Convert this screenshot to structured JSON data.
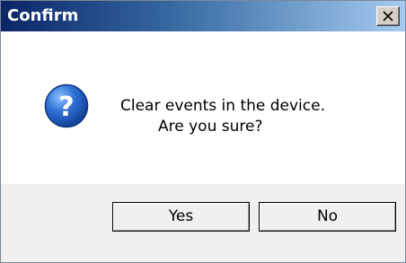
{
  "dialog": {
    "title": "Confirm",
    "close_icon": "close-icon",
    "question_icon": "question-icon",
    "message_line1": "Clear events in the device.",
    "message_line2": "Are you sure?",
    "yes_label": "Yes",
    "no_label": "No"
  },
  "colors": {
    "titlebar_start": "#0b246a",
    "titlebar_end": "#a6caf0",
    "icon_blue": "#1f5fbf"
  }
}
